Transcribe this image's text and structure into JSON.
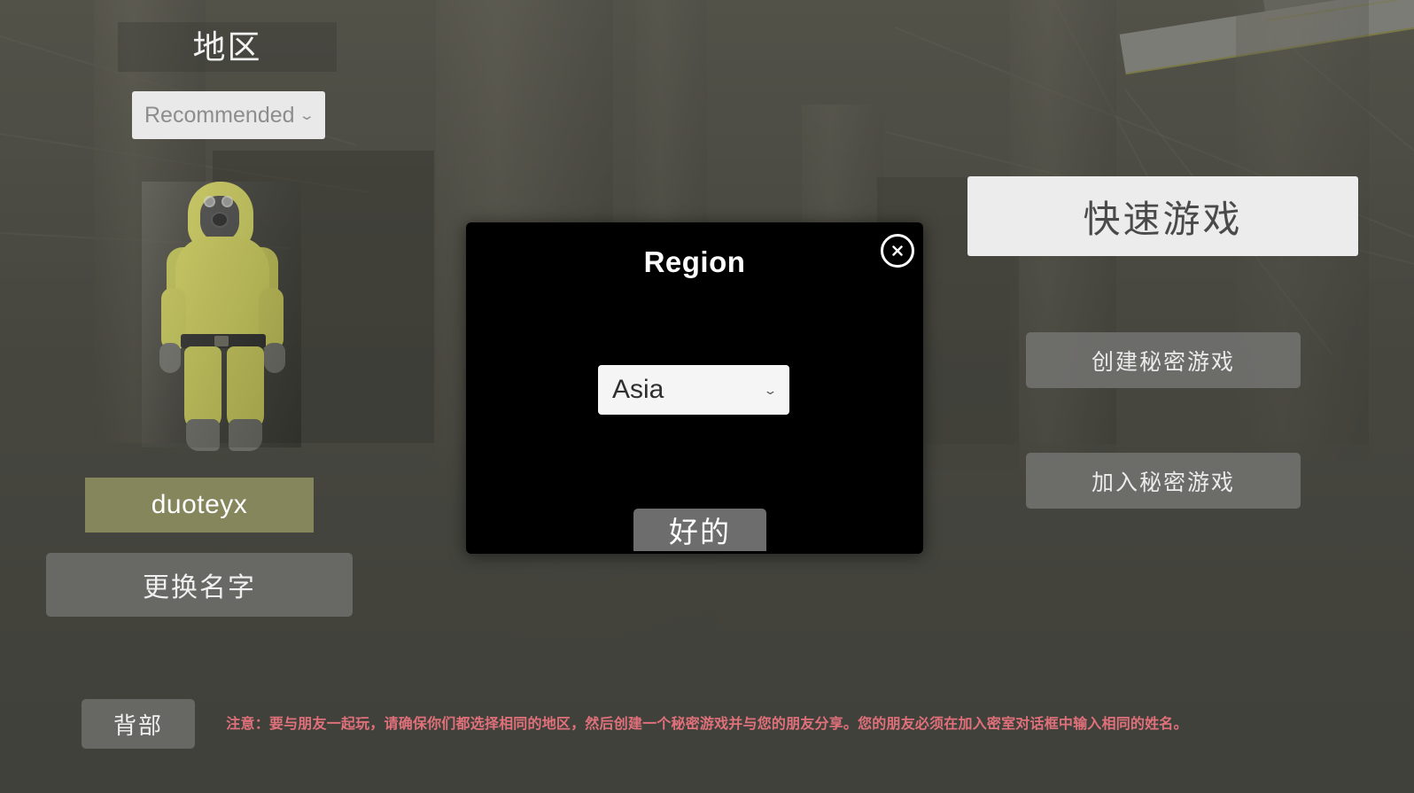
{
  "background": {
    "description": "dimmed 3d game lobby scene with concrete pillars, ceiling grid and a lit ceiling panel",
    "scene_tint": "#5a5a54",
    "light_panel_color": "#b9b9b4"
  },
  "character": {
    "name": "hazmat-suit-avatar",
    "suit_color": "#c8c85a",
    "mask_color": "#4a4a48",
    "boot_color": "#6b6b65"
  },
  "left_panel": {
    "region_title": "地区",
    "region_dropdown": {
      "value": "Recommended",
      "chevron": "chevron-down-icon"
    },
    "player_name": "duoteyx",
    "change_name_button": "更换名字",
    "back_button": "背部"
  },
  "right_panel": {
    "quick_game_button": "快速游戏",
    "create_private_game_button": "创建秘密游戏",
    "join_private_game_button": "加入秘密游戏"
  },
  "warning": {
    "text": "注意：要与朋友一起玩，请确保你们都选择相同的地区，然后创建一个秘密游戏并与您的朋友分享。您的朋友必须在加入密室对话框中输入相同的姓名。",
    "color": "#e0707a"
  },
  "modal": {
    "title": "Region",
    "close_icon": "close-icon",
    "region_select": {
      "value": "Asia",
      "chevron": "chevron-down-icon"
    },
    "ok_button": "好的",
    "background_color": "#000000"
  }
}
